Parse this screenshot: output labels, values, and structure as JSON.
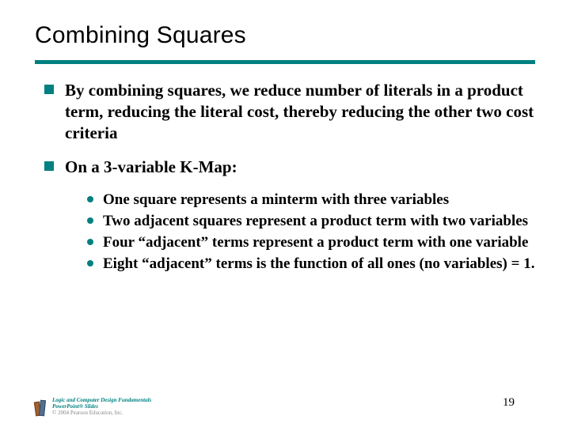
{
  "title": "Combining Squares",
  "bullets": [
    {
      "text": "By combining squares, we reduce number of literals in a product term, reducing the literal cost, thereby reducing the other two cost criteria"
    },
    {
      "text": "On a 3-variable K-Map:",
      "sub": [
        "One square represents a minterm with three variables",
        "Two adjacent squares represent a product term with two variables",
        "Four “adjacent” terms represent a product term with one variable",
        "Eight “adjacent” terms is the function of all ones (no variables) = 1."
      ]
    }
  ],
  "footer": {
    "line1": "Logic and Computer Design Fundamentals",
    "line2": "PowerPoint® Slides",
    "line3": "© 2004 Pearson Education, Inc."
  },
  "page_number": "19"
}
